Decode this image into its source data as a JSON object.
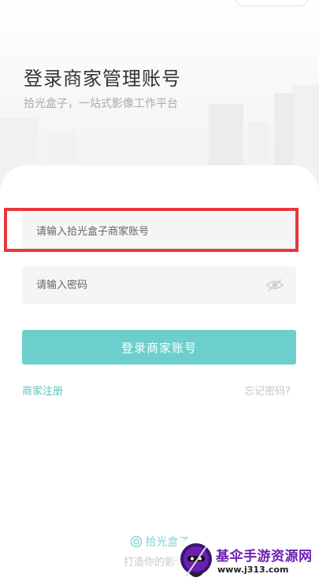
{
  "header": {
    "title": "登录商家管理账号",
    "subtitle": "拾光盒子，一站式影像工作平台"
  },
  "form": {
    "account_placeholder": "请输入拾光盒子商家账号",
    "account_value": "",
    "password_placeholder": "请输入密码",
    "password_value": "",
    "password_toggle_icon": "eye-icon",
    "login_label": "登录商家账号",
    "register_label": "商家注册",
    "forgot_label": "忘记密码?"
  },
  "footer": {
    "brand_icon": "swirl-icon",
    "brand_name": "拾光盒子",
    "slogan": "打造你的影像工"
  },
  "watermark": {
    "title": "基伞手游资源网",
    "url": "www.j313.com"
  },
  "colors": {
    "accent": "#6ccfcb",
    "link": "#5cc3bf",
    "highlight": "#e8383d"
  }
}
